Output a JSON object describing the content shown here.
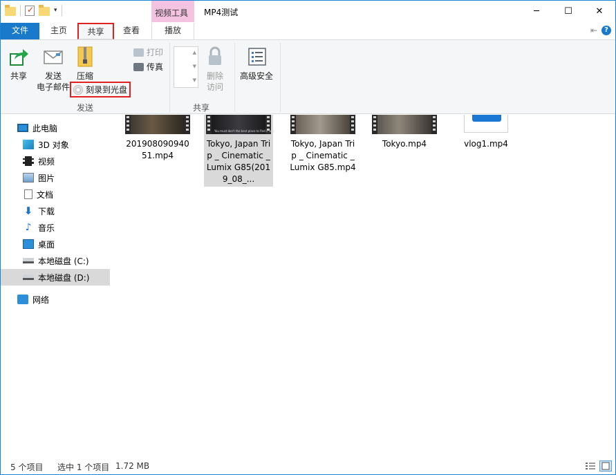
{
  "window": {
    "title": "MP4测试",
    "context_tab_group": "视频工具",
    "controls": {
      "minimize": "─",
      "maximize": "☐",
      "close": "✕"
    }
  },
  "quick_access": {
    "dropdown": "▾"
  },
  "ribbon_tabs": {
    "file": "文件",
    "home": "主页",
    "share": "共享",
    "view": "查看",
    "play": "播放",
    "collapse": "⇤",
    "help": "?"
  },
  "ribbon": {
    "send_group": {
      "label": "发送",
      "share": "共享",
      "email_line1": "发送",
      "email_line2": "电子邮件",
      "zip": "压缩",
      "burn": "刻录到光盘",
      "print": "打印",
      "fax": "传真"
    },
    "share_group": {
      "label": "共享",
      "remove_line1": "删除",
      "remove_line2": "访问",
      "advanced": "高级安全"
    }
  },
  "nav": {
    "items": [
      {
        "label": "此电脑",
        "icon": "pc-icon"
      },
      {
        "label": "3D 对象",
        "icon": "3d-objects-icon"
      },
      {
        "label": "视频",
        "icon": "videos-icon"
      },
      {
        "label": "图片",
        "icon": "pictures-icon"
      },
      {
        "label": "文档",
        "icon": "documents-icon"
      },
      {
        "label": "下载",
        "icon": "downloads-icon"
      },
      {
        "label": "音乐",
        "icon": "music-icon"
      },
      {
        "label": "桌面",
        "icon": "desktop-icon"
      },
      {
        "label": "本地磁盘 (C:)",
        "icon": "drive-icon"
      },
      {
        "label": "本地磁盘 (D:)",
        "icon": "drive-icon",
        "selected": true
      },
      {
        "label": "网络",
        "icon": "network-icon"
      }
    ]
  },
  "files": [
    {
      "name": "20190809094051.mp4",
      "thumb": "video-thumbnail"
    },
    {
      "name": "Tokyo, Japan Trip _ Cinematic _ Lumix G85(2019_08_...",
      "thumb": "video-thumbnail",
      "caption": "You must don't the best place to find a loop",
      "selected": true
    },
    {
      "name": "Tokyo, Japan Trip _ Cinematic _ Lumix G85.mp4",
      "thumb": "video-thumbnail"
    },
    {
      "name": "Tokyo.mp4",
      "thumb": "video-thumbnail"
    },
    {
      "name": "vlog1.mp4",
      "thumb": "document-thumbnail"
    }
  ],
  "status": {
    "item_count": "5 个项目",
    "selection": "选中 1 个项目",
    "size": "1.72 MB"
  },
  "colors": {
    "accent": "#1979ca",
    "context_tab": "#f4c3e2",
    "highlight_border": "#e32020",
    "selection": "#d9d9d9"
  }
}
